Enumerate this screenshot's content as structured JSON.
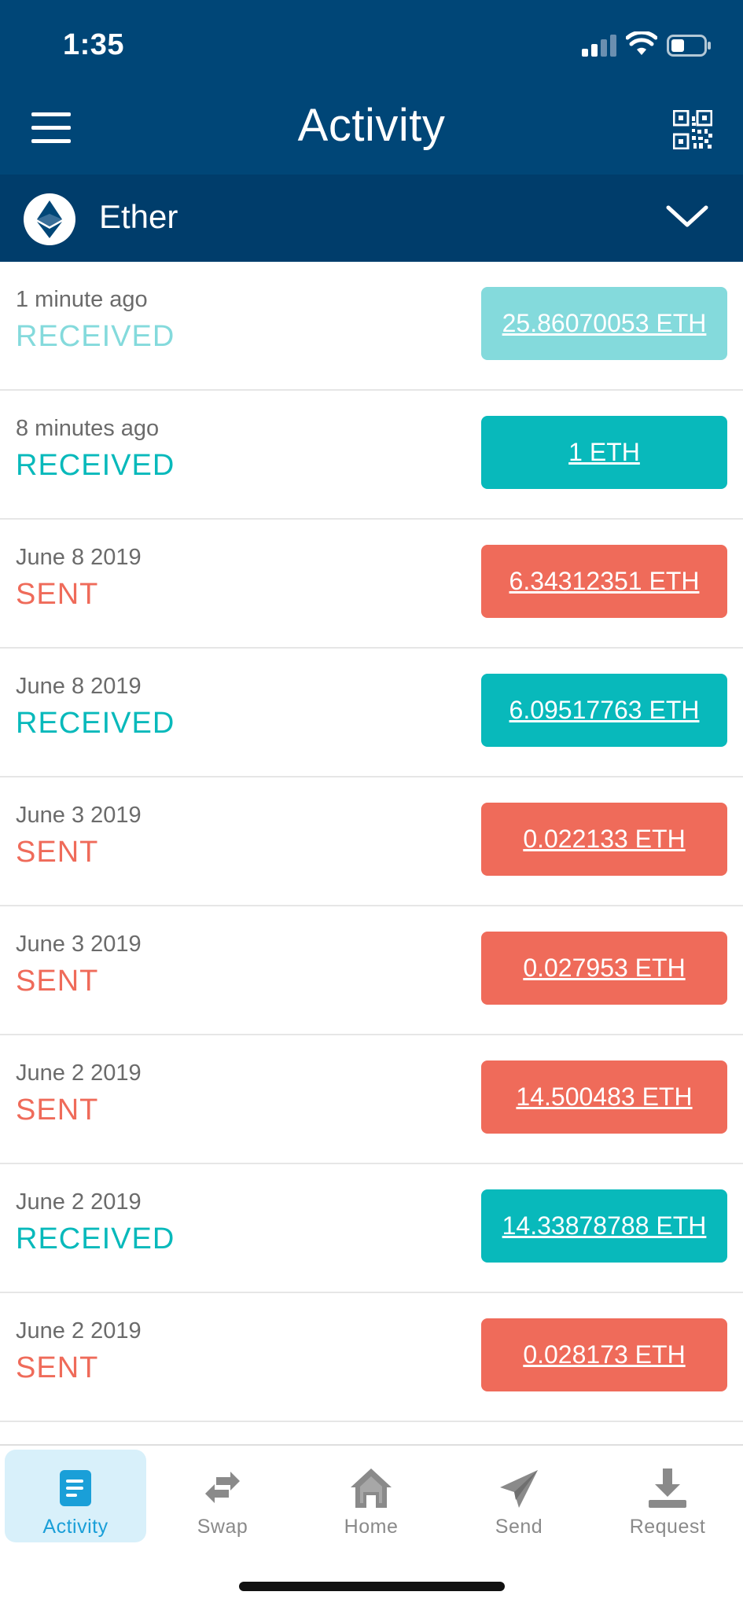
{
  "status_bar": {
    "time": "1:35"
  },
  "header": {
    "title": "Activity"
  },
  "currency": {
    "name": "Ether"
  },
  "colors": {
    "header": "#004677",
    "received": "#08b9bb",
    "received_pending": "#84dadc",
    "sent": "#ef6b5a",
    "active_tab": "#1a9fd8"
  },
  "transactions": [
    {
      "date": "1 minute ago",
      "status": "RECEIVED",
      "amount": "25.86070053 ETH",
      "kind": "received_pending"
    },
    {
      "date": "8 minutes ago",
      "status": "RECEIVED",
      "amount": "1 ETH",
      "kind": "received"
    },
    {
      "date": "June 8 2019",
      "status": "SENT",
      "amount": "6.34312351 ETH",
      "kind": "sent"
    },
    {
      "date": "June 8 2019",
      "status": "RECEIVED",
      "amount": "6.09517763 ETH",
      "kind": "received"
    },
    {
      "date": "June 3 2019",
      "status": "SENT",
      "amount": "0.022133 ETH",
      "kind": "sent"
    },
    {
      "date": "June 3 2019",
      "status": "SENT",
      "amount": "0.027953 ETH",
      "kind": "sent"
    },
    {
      "date": "June 2 2019",
      "status": "SENT",
      "amount": "14.500483 ETH",
      "kind": "sent"
    },
    {
      "date": "June 2 2019",
      "status": "RECEIVED",
      "amount": "14.33878788 ETH",
      "kind": "received"
    },
    {
      "date": "June 2 2019",
      "status": "SENT",
      "amount": "0.028173 ETH",
      "kind": "sent"
    }
  ],
  "tabs": [
    {
      "label": "Activity",
      "icon": "activity-icon",
      "active": true
    },
    {
      "label": "Swap",
      "icon": "swap-icon",
      "active": false
    },
    {
      "label": "Home",
      "icon": "home-icon",
      "active": false
    },
    {
      "label": "Send",
      "icon": "send-icon",
      "active": false
    },
    {
      "label": "Request",
      "icon": "request-icon",
      "active": false
    }
  ]
}
